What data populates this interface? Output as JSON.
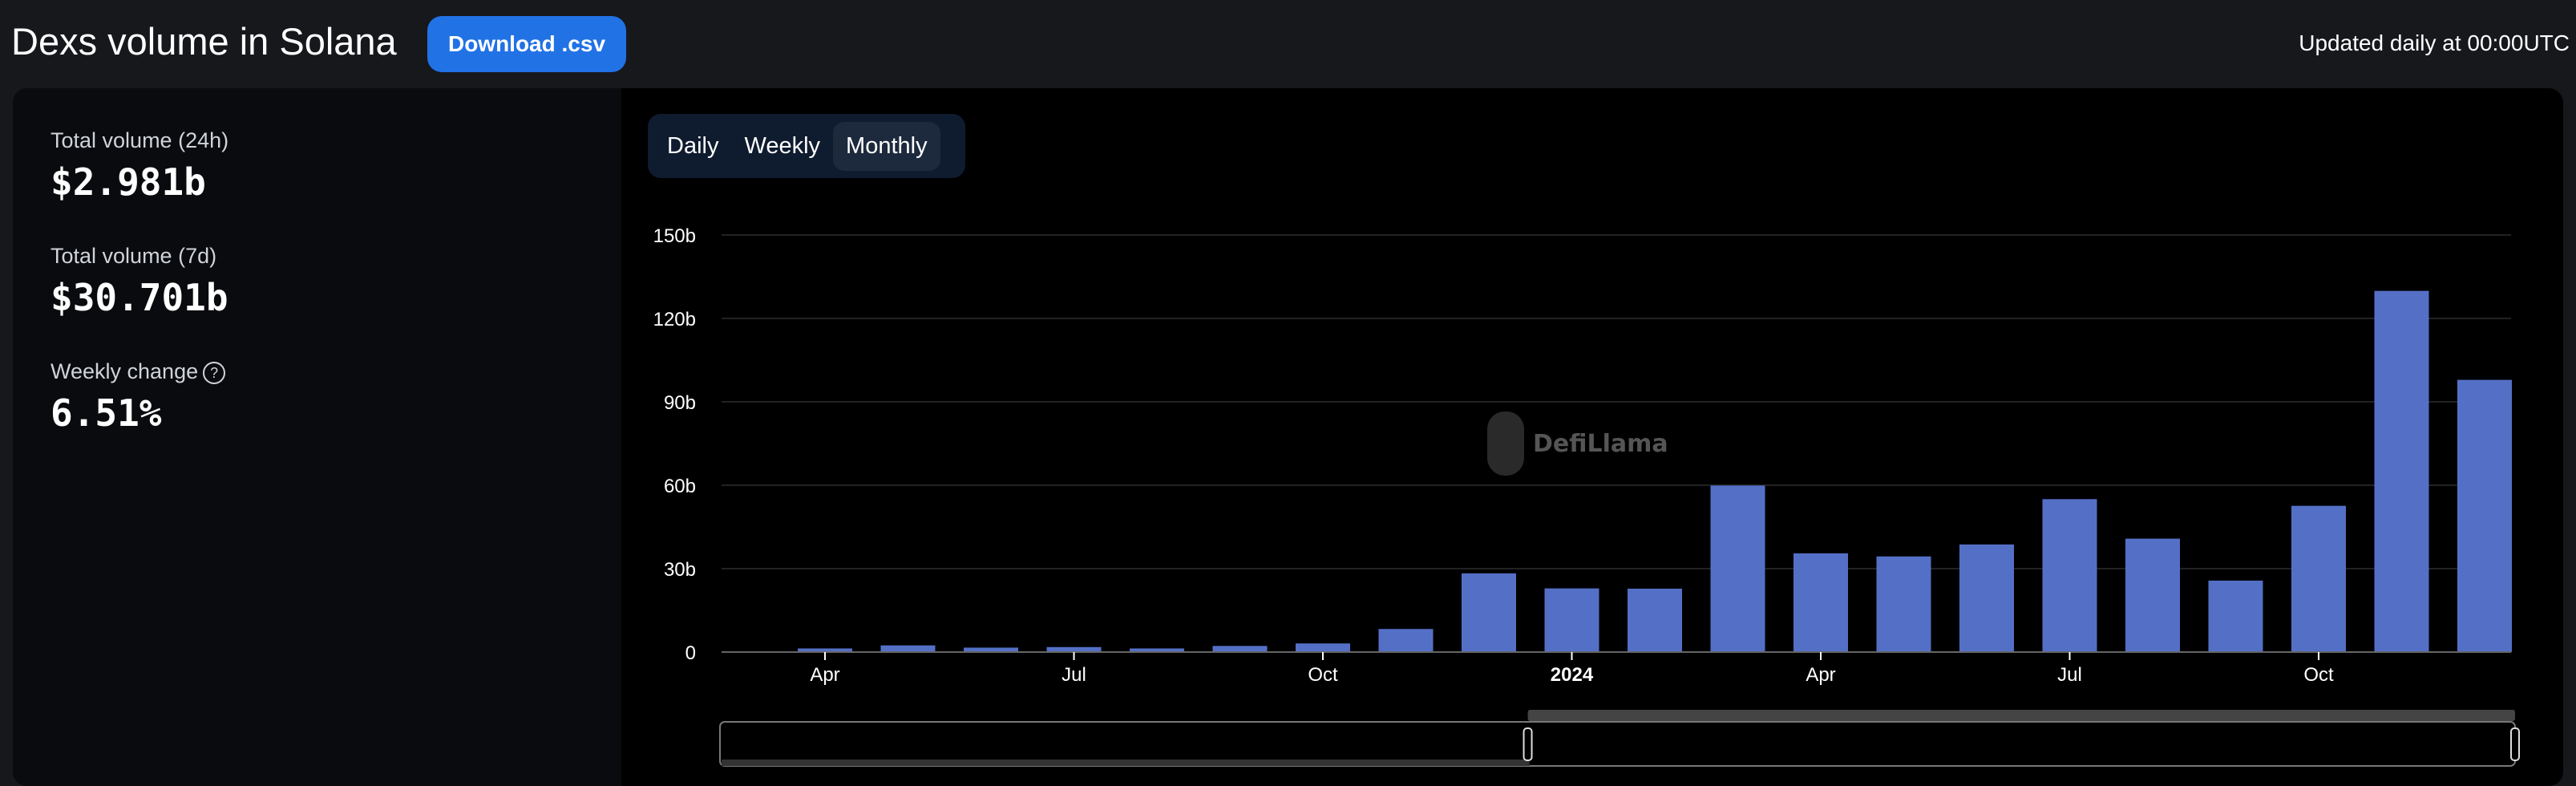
{
  "header": {
    "title": "Dexs volume in Solana",
    "download_label": "Download .csv",
    "updated": "Updated daily at 00:00UTC"
  },
  "stats": [
    {
      "label": "Total volume (24h)",
      "value": "$2.981b"
    },
    {
      "label": "Total volume (7d)",
      "value": "$30.701b"
    },
    {
      "label": "Weekly change",
      "value": "6.51%",
      "help_icon": "?"
    }
  ],
  "tabs": [
    {
      "label": "Daily"
    },
    {
      "label": "Weekly"
    },
    {
      "label": "Monthly",
      "active": true
    }
  ],
  "watermark": "DefiLlama",
  "colors": {
    "bar": "#5470c6",
    "accent": "#2172e5"
  },
  "chart_data": {
    "type": "bar",
    "title": "",
    "xlabel": "",
    "ylabel": "",
    "ylim": [
      0,
      150
    ],
    "yticks": [
      {
        "v": 0,
        "label": "0"
      },
      {
        "v": 30,
        "label": "30b"
      },
      {
        "v": 60,
        "label": "60b"
      },
      {
        "v": 90,
        "label": "90b"
      },
      {
        "v": 120,
        "label": "120b"
      },
      {
        "v": 150,
        "label": "150b"
      }
    ],
    "categories": [
      "2023-04",
      "2023-05",
      "2023-06",
      "2023-07",
      "2023-08",
      "2023-09",
      "2023-10",
      "2023-11",
      "2023-12",
      "2024-01",
      "2024-02",
      "2024-03",
      "2024-04",
      "2024-05",
      "2024-06",
      "2024-07",
      "2024-08",
      "2024-09",
      "2024-10",
      "2024-11",
      "2024-12"
    ],
    "values": [
      1.3,
      2.4,
      1.6,
      1.8,
      1.3,
      2.2,
      3.1,
      8.3,
      28.3,
      22.9,
      22.8,
      59.9,
      35.5,
      34.4,
      38.7,
      55.0,
      40.8,
      25.7,
      52.6,
      129.9,
      97.9
    ],
    "xticks": [
      {
        "i": 0,
        "label": "Apr"
      },
      {
        "i": 3,
        "label": "Jul"
      },
      {
        "i": 6,
        "label": "Oct"
      },
      {
        "i": 9,
        "label": "2024",
        "bold": true
      },
      {
        "i": 12,
        "label": "Apr"
      },
      {
        "i": 15,
        "label": "Jul"
      },
      {
        "i": 18,
        "label": "Oct"
      }
    ],
    "grid": true,
    "unit": "USD billions",
    "zoom_range_start_fraction": 0.45
  }
}
